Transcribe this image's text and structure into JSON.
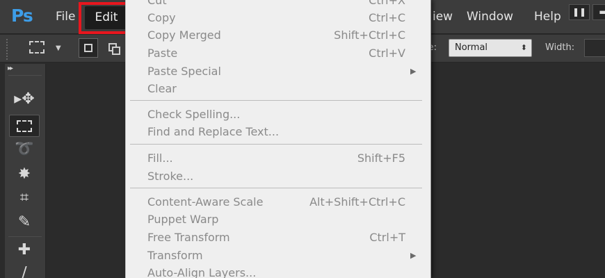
{
  "app": {
    "logo": "Ps"
  },
  "menubar": {
    "items": [
      "File",
      "Edit",
      "View",
      "Window",
      "Help"
    ],
    "visible_fragments": {
      "view": "iew"
    }
  },
  "options_bar": {
    "style_label": "le:",
    "style_value": "Normal",
    "width_label": "Width:"
  },
  "edit_menu": {
    "groups": [
      [
        {
          "label": "Cut",
          "shortcut": "Ctrl+X",
          "state": "partially visible at top"
        },
        {
          "label": "Copy",
          "shortcut": "Ctrl+C"
        },
        {
          "label": "Copy Merged",
          "shortcut": "Shift+Ctrl+C"
        },
        {
          "label": "Paste",
          "shortcut": "Ctrl+V"
        },
        {
          "label": "Paste Special",
          "submenu": true
        },
        {
          "label": "Clear"
        }
      ],
      [
        {
          "label": "Check Spelling..."
        },
        {
          "label": "Find and Replace Text..."
        }
      ],
      [
        {
          "label": "Fill...",
          "shortcut": "Shift+F5"
        },
        {
          "label": "Stroke..."
        }
      ],
      [
        {
          "label": "Content-Aware Scale",
          "shortcut": "Alt+Shift+Ctrl+C"
        },
        {
          "label": "Puppet Warp"
        },
        {
          "label": "Free Transform",
          "shortcut": "Ctrl+T"
        },
        {
          "label": "Transform",
          "submenu": true
        },
        {
          "label": "Auto-Align Layers..."
        }
      ]
    ]
  },
  "highlight": {
    "target": "Edit menu",
    "color": "#e8161e"
  },
  "colors": {
    "menubar": "#3c3c3c",
    "menu_bg": "#efefef",
    "menu_text": "#8a8a8a",
    "logo": "#3d9de8"
  }
}
